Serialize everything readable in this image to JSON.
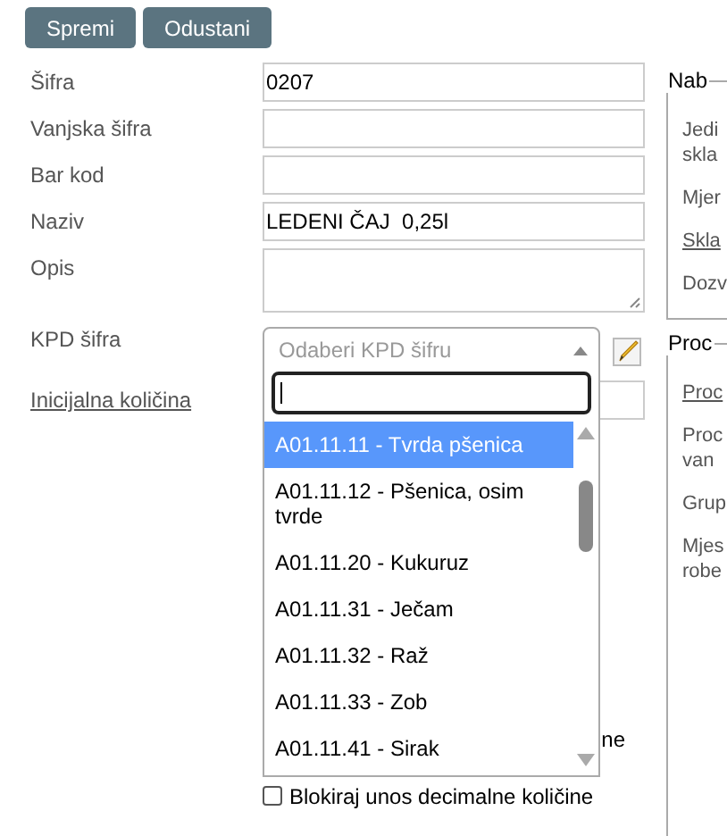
{
  "buttons": [
    {
      "label": "Spremi"
    },
    {
      "label": "Odustani"
    }
  ],
  "fields": [
    {
      "label": "Šifra",
      "kind": "input",
      "value": "0207",
      "link": false
    },
    {
      "label": "Vanjska šifra",
      "kind": "input",
      "link": false
    },
    {
      "label": "Bar kod",
      "kind": "input",
      "link": false
    },
    {
      "label": "Naziv",
      "kind": "input",
      "value": "LEDENI ČAJ  0,25l",
      "link": false
    },
    {
      "label": "Opis",
      "kind": "textarea",
      "link": false
    },
    {
      "label": "KPD šifra",
      "kind": "select",
      "placeholder": "Odaberi KPD šifru",
      "link": false
    },
    {
      "label": "Inicijalna količina",
      "kind": "input",
      "link": true
    }
  ],
  "dropdown": {
    "options": [
      {
        "label": "A01.11.11 - Tvrda pšenica",
        "selected": true
      },
      {
        "label": "A01.11.12 - Pšenica, osim tvrde",
        "selected": false
      },
      {
        "label": "A01.11.20 - Kukuruz",
        "selected": false
      },
      {
        "label": "A01.11.31 - Ječam",
        "selected": false
      },
      {
        "label": "A01.11.32 - Raž",
        "selected": false
      },
      {
        "label": "A01.11.33 - Zob",
        "selected": false
      },
      {
        "label": "A01.11.41 - Sirak",
        "selected": false
      }
    ]
  },
  "checkboxes": [
    {
      "label": "ne"
    },
    {
      "label": "Blokiraj unos decimalne količine",
      "checked": false
    }
  ],
  "panels": [
    {
      "legend": "Nab",
      "items": [
        {
          "lines": [
            "Jedi",
            "skla"
          ],
          "link": false
        },
        {
          "lines": [
            "Mjer"
          ],
          "link": false
        },
        {
          "lines": [
            "Skla"
          ],
          "link": true
        },
        {
          "lines": [
            "Dozv"
          ],
          "link": false
        }
      ]
    },
    {
      "legend": "Proc",
      "items": [
        {
          "lines": [
            "Proc"
          ],
          "link": true
        },
        {
          "lines": [
            "Proc",
            "van"
          ],
          "link": false
        },
        {
          "lines": [
            "Grup"
          ],
          "link": false
        },
        {
          "lines": [
            "Mjes",
            "robe"
          ],
          "link": false
        }
      ]
    }
  ]
}
